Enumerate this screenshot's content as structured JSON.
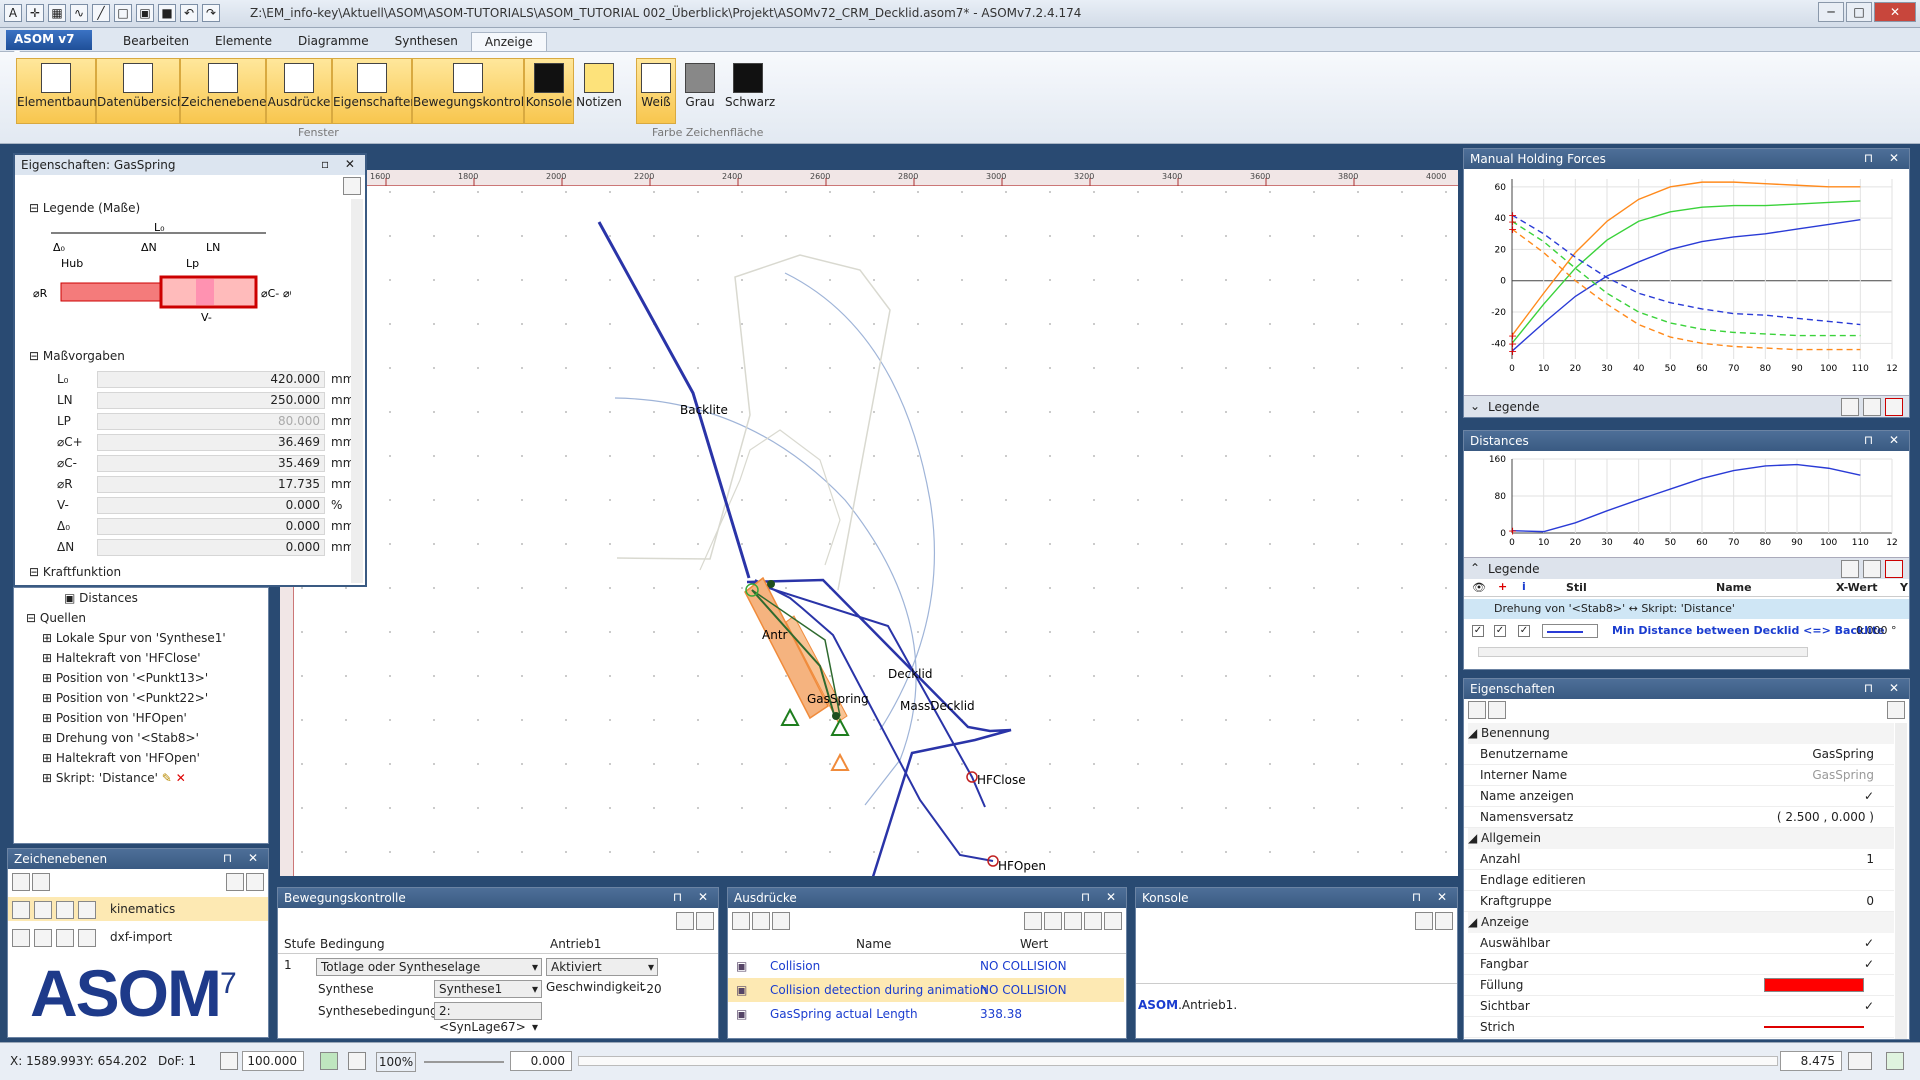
{
  "window": {
    "title": "Z:\\EM_info-key\\Aktuell\\ASOM\\ASOM-TUTORIALS\\ASOM_TUTORIAL 002_Überblick\\Projekt\\ASOMv72_CRM_Decklid.asom7* - ASOMv7.2.4.174"
  },
  "menu": {
    "app_button": "ASOM v7 ▾",
    "tabs": [
      "Bearbeiten",
      "Elemente",
      "Diagramme",
      "Synthesen",
      "Anzeige"
    ]
  },
  "ribbon": {
    "fenster": [
      "Elementbaum",
      "Datenübersicht",
      "Zeichenebenen",
      "Ausdrücke",
      "Eigenschaften",
      "Bewegungskontrolle",
      "Konsole",
      "Notizen"
    ],
    "fenster_group": "Fenster",
    "farbe": [
      "Weiß",
      "Grau",
      "Schwarz"
    ],
    "farbe_group": "Farbe Zeichenfläche"
  },
  "ruler": {
    "ticks": [
      "1600",
      "1800",
      "2000",
      "2200",
      "2400",
      "2600",
      "2800",
      "3000",
      "3200",
      "3400",
      "3600",
      "3800",
      "4000"
    ]
  },
  "canvas_labels": {
    "backlite": "Backlite",
    "decklid": "Decklid",
    "gasspring": "GasSpring",
    "massdecklid": "MassDecklid",
    "hfclose": "HFClose",
    "hfopen": "HFOpen",
    "antr": "Antr"
  },
  "props_float": {
    "title": "Eigenschaften: GasSpring",
    "legend_section": "Legende (Maße)",
    "diagram": {
      "l0": "L₀",
      "delta0": "Δ₀",
      "deltaN": "ΔN",
      "ln": "LN",
      "hub": "Hub",
      "lp": "Lp",
      "dr": "⌀R",
      "dcm": "⌀C-",
      "dcp": "⌀C+",
      "vm": "V-"
    },
    "mass_section": "Maßvorgaben",
    "rows": [
      {
        "name": "L₀",
        "value": "420.000",
        "unit": "mm"
      },
      {
        "name": "LN",
        "value": "250.000",
        "unit": "mm"
      },
      {
        "name": "LP",
        "value": "80.000",
        "unit": "mm"
      },
      {
        "name": "⌀C+",
        "value": "36.469",
        "unit": "mm"
      },
      {
        "name": "⌀C-",
        "value": "35.469",
        "unit": "mm"
      },
      {
        "name": "⌀R",
        "value": "17.735",
        "unit": "mm"
      },
      {
        "name": "V-",
        "value": "0.000",
        "unit": "%"
      },
      {
        "name": "Δ₀",
        "value": "0.000",
        "unit": "mm"
      },
      {
        "name": "ΔN",
        "value": "0.000",
        "unit": "mm"
      }
    ],
    "kraft_section": "Kraftfunktion"
  },
  "tree": {
    "distances": "Distances",
    "quellen": "Quellen",
    "items": [
      "Lokale Spur von 'Synthese1'",
      "Haltekraft von 'HFClose'",
      "Position von '<Punkt13>'",
      "Position von '<Punkt22>'",
      "Position von 'HFOpen'",
      "Drehung von '<Stab8>'",
      "Haltekraft von 'HFOpen'",
      "Skript: 'Distance'"
    ]
  },
  "zeichenebenen": {
    "title": "Zeichenebenen",
    "layers": [
      "kinematics",
      "dxf-import"
    ],
    "logo": "ASOM",
    "logo_sup": "7"
  },
  "bewegung": {
    "title": "Bewegungskontrolle",
    "headers": [
      "Stufe",
      "Bedingung",
      "Antrieb1"
    ],
    "stufe": "1",
    "bedingung": "Totlage oder Syntheselage",
    "antrieb": "Aktiviert",
    "synthese_label": "Synthese",
    "synthese_val": "Synthese1",
    "geschw_label": "Geschwindigkeit",
    "geschw_val": "-20",
    "sb_label": "Synthesebedingung",
    "sb_val": "2: <SynLage67>"
  },
  "ausdruecke": {
    "title": "Ausdrücke",
    "headers": [
      "Name",
      "Wert"
    ],
    "rows": [
      {
        "name": "Collision",
        "value": "NO COLLISION"
      },
      {
        "name": "Collision detection during animation",
        "value": "NO COLLISION"
      },
      {
        "name": "GasSpring actual Length",
        "value": "338.38"
      }
    ]
  },
  "konsole": {
    "title": "Konsole",
    "prefix": "ASOM",
    "text": ".Antrieb1."
  },
  "mhf": {
    "title": "Manual Holding Forces",
    "legend": "Legende"
  },
  "distances": {
    "title": "Distances",
    "legend": "Legende",
    "cols": [
      "Stil",
      "Name",
      "X-Wert",
      "Y"
    ],
    "group": "Drehung von '<Stab8>' ↔ Skript: 'Distance'",
    "row_name": "Min Distance between Decklid <=> Backlite",
    "row_x": "0.000 °"
  },
  "eigenschaften": {
    "title": "Eigenschaften",
    "groups": [
      {
        "name": "Benennung",
        "rows": [
          {
            "k": "Benutzername",
            "v": "GasSpring"
          },
          {
            "k": "Interner Name",
            "v": "GasSpring"
          },
          {
            "k": "Name anzeigen",
            "v": "✓"
          },
          {
            "k": "Namensversatz",
            "v": "(          2.500          ,          0.000          )"
          }
        ]
      },
      {
        "name": "Allgemein",
        "rows": [
          {
            "k": "Anzahl",
            "v": "1"
          },
          {
            "k": "Endlage editieren",
            "v": ""
          },
          {
            "k": "Kraftgruppe",
            "v": "0"
          }
        ]
      },
      {
        "name": "Anzeige",
        "rows": [
          {
            "k": "Auswählbar",
            "v": "✓"
          },
          {
            "k": "Fangbar",
            "v": "✓"
          },
          {
            "k": "Füllung",
            "v": ""
          },
          {
            "k": "Sichtbar",
            "v": "✓"
          },
          {
            "k": "Strich",
            "v": ""
          }
        ]
      }
    ]
  },
  "status": {
    "x": "X: 1589.993",
    "y": "Y: 654.202",
    "dof": "DoF: 1",
    "speed": "100.000",
    "zoom": "100%",
    "pos": "0.000",
    "right_val": "8.475"
  },
  "chart_data": [
    {
      "type": "line",
      "title": "Manual Holding Forces",
      "x": [
        0,
        10,
        20,
        30,
        40,
        50,
        60,
        70,
        80,
        90,
        100,
        110
      ],
      "xlim": [
        0,
        120
      ],
      "ylim": [
        -50,
        65
      ],
      "yticks": [
        60,
        40,
        20,
        0,
        -20,
        -40
      ],
      "xticks": [
        0,
        10,
        20,
        30,
        40,
        50,
        60,
        70,
        80,
        90,
        100,
        110,
        12
      ],
      "series": [
        {
          "color": "#ff8a1c",
          "dash": false,
          "values": [
            -35,
            -8,
            18,
            38,
            52,
            60,
            63,
            63,
            62,
            61,
            60,
            60
          ]
        },
        {
          "color": "#3ad23a",
          "dash": false,
          "values": [
            -40,
            -15,
            8,
            26,
            38,
            44,
            47,
            48,
            48,
            49,
            50,
            51
          ]
        },
        {
          "color": "#2a3bd6",
          "dash": false,
          "values": [
            -45,
            -27,
            -10,
            3,
            12,
            20,
            25,
            28,
            30,
            33,
            36,
            39
          ]
        },
        {
          "color": "#2a3bd6",
          "dash": true,
          "values": [
            42,
            30,
            15,
            2,
            -8,
            -14,
            -18,
            -21,
            -22,
            -24,
            -26,
            -28
          ]
        },
        {
          "color": "#3ad23a",
          "dash": true,
          "values": [
            38,
            25,
            8,
            -8,
            -20,
            -27,
            -31,
            -33,
            -34,
            -35,
            -35,
            -35
          ]
        },
        {
          "color": "#ff8a1c",
          "dash": true,
          "values": [
            33,
            18,
            0,
            -15,
            -28,
            -36,
            -40,
            -42,
            -43,
            -44,
            -44,
            -44
          ]
        }
      ]
    },
    {
      "type": "line",
      "title": "Distances",
      "x": [
        0,
        10,
        20,
        30,
        40,
        50,
        60,
        70,
        80,
        90,
        100,
        110
      ],
      "xlim": [
        0,
        120
      ],
      "ylim": [
        0,
        160
      ],
      "yticks": [
        160,
        80,
        0
      ],
      "xticks": [
        0,
        10,
        20,
        30,
        40,
        50,
        60,
        70,
        80,
        90,
        100,
        110,
        12
      ],
      "series": [
        {
          "name": "Min Distance between Decklid <=> Backlite",
          "color": "#2a3bd6",
          "dash": false,
          "values": [
            5,
            3,
            22,
            48,
            72,
            95,
            118,
            135,
            145,
            148,
            140,
            125
          ]
        }
      ]
    }
  ]
}
